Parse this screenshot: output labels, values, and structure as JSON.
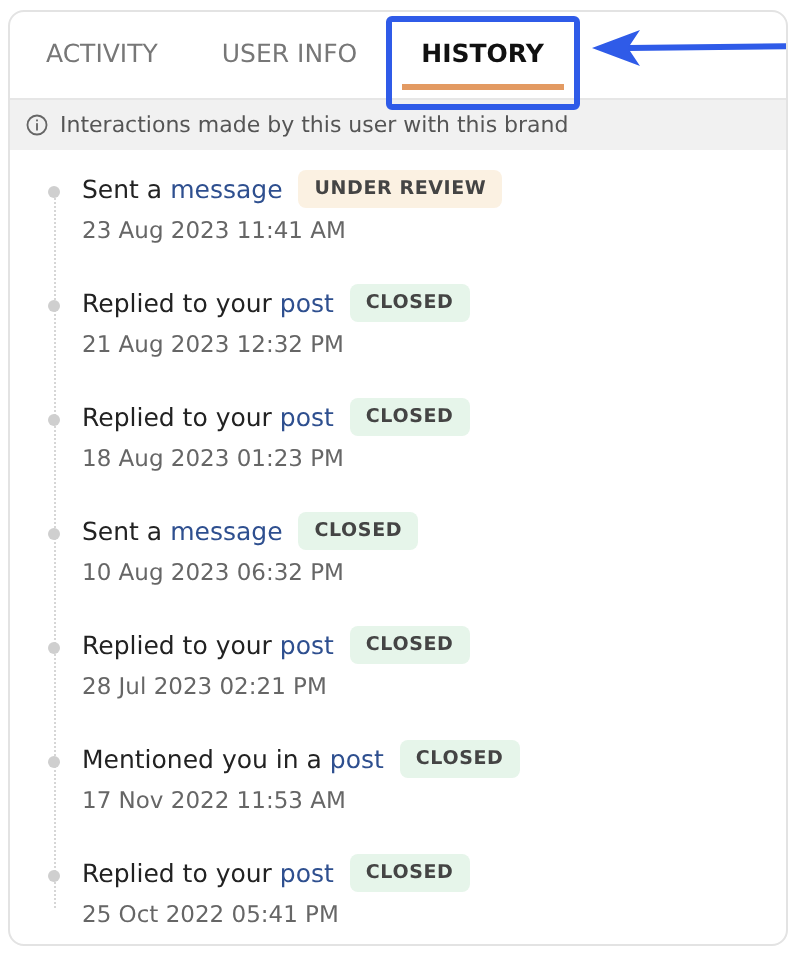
{
  "tabs": [
    {
      "label": "ACTIVITY",
      "selected": false
    },
    {
      "label": "USER INFO",
      "selected": false
    },
    {
      "label": "HISTORY",
      "selected": true
    }
  ],
  "info": {
    "text": "Interactions made by this user with this brand"
  },
  "history": [
    {
      "text": "Sent a",
      "link": "message",
      "status": {
        "kind": "review",
        "label": "UNDER REVIEW"
      },
      "time": "23 Aug 2023 11:41 AM"
    },
    {
      "text": "Replied to your",
      "link": "post",
      "status": {
        "kind": "closed",
        "label": "CLOSED"
      },
      "time": "21 Aug 2023 12:32 PM"
    },
    {
      "text": "Replied to your",
      "link": "post",
      "status": {
        "kind": "closed",
        "label": "CLOSED"
      },
      "time": "18 Aug 2023 01:23 PM"
    },
    {
      "text": "Sent a",
      "link": "message",
      "status": {
        "kind": "closed",
        "label": "CLOSED"
      },
      "time": "10 Aug 2023 06:32 PM"
    },
    {
      "text": "Replied to your",
      "link": "post",
      "status": {
        "kind": "closed",
        "label": "CLOSED"
      },
      "time": "28 Jul 2023 02:21 PM"
    },
    {
      "text": "Mentioned you in a",
      "link": "post",
      "status": {
        "kind": "closed",
        "label": "CLOSED"
      },
      "time": "17 Nov 2022 11:53 AM"
    },
    {
      "text": "Replied to your",
      "link": "post",
      "status": {
        "kind": "closed",
        "label": "CLOSED"
      },
      "time": "25 Oct 2022 05:41 PM"
    }
  ]
}
